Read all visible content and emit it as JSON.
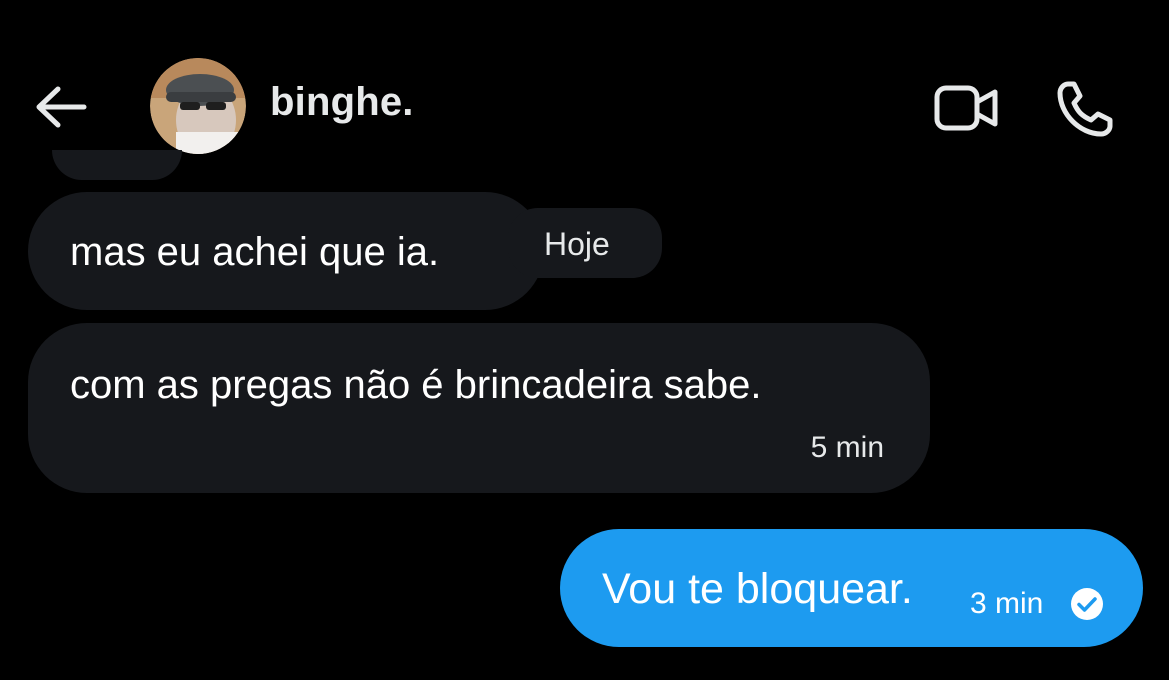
{
  "header": {
    "contact_name": "binghe.",
    "back_icon": "arrow-left-icon",
    "video_icon": "video-camera-icon",
    "call_icon": "phone-icon"
  },
  "messages": [
    {
      "direction": "received",
      "text": "mas eu achei que ia."
    },
    {
      "direction": "received",
      "text": "com as pregas não é brincadeira sabe.",
      "time": "5 min"
    },
    {
      "direction": "sent",
      "text": "Vou te bloquear.",
      "time": "3 min",
      "status_icon": "read-check-icon"
    }
  ],
  "date_separator": "Hoje",
  "colors": {
    "background": "#000000",
    "received_bubble": "#16181c",
    "sent_bubble": "#1d9bf0",
    "text": "#ffffff"
  }
}
